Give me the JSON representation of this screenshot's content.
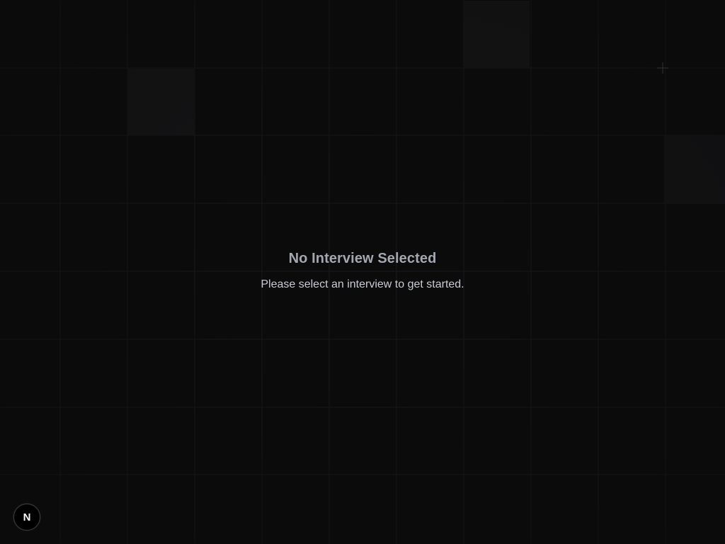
{
  "empty_state": {
    "title": "No Interview Selected",
    "subtitle": "Please select an interview to get started."
  },
  "dev_indicator": {
    "letter": "N",
    "icon": "nextjs-logo-icon"
  },
  "colors": {
    "background": "#0b0b0c",
    "grid_line": "#1a1a1c",
    "tile": "#161617",
    "title_text": "#a3a7b0",
    "subtitle_text": "#c9ccd2"
  }
}
